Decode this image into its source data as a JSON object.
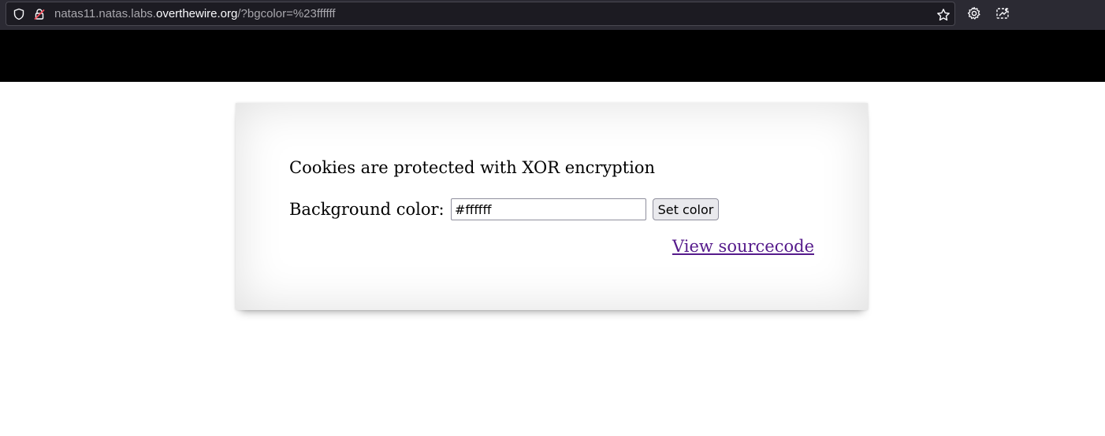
{
  "browser": {
    "url_prefix": "natas11.natas.labs.",
    "url_domain": "overthewire.org",
    "url_path": "/?bgcolor=%23ffffff",
    "icons": [
      "shield-icon",
      "lock-insecure-icon",
      "star-icon",
      "gear-icon",
      "extension-icon"
    ]
  },
  "page": {
    "message": "Cookies are protected with XOR encryption",
    "form": {
      "label": "Background color:",
      "value": "#ffffff",
      "submit": "Set color"
    },
    "source_link": "View sourcecode"
  },
  "colors": {
    "chrome": "#2b2a33",
    "urlbar": "#1c1b22",
    "header": "#000000",
    "link_visited": "#551a8b"
  }
}
